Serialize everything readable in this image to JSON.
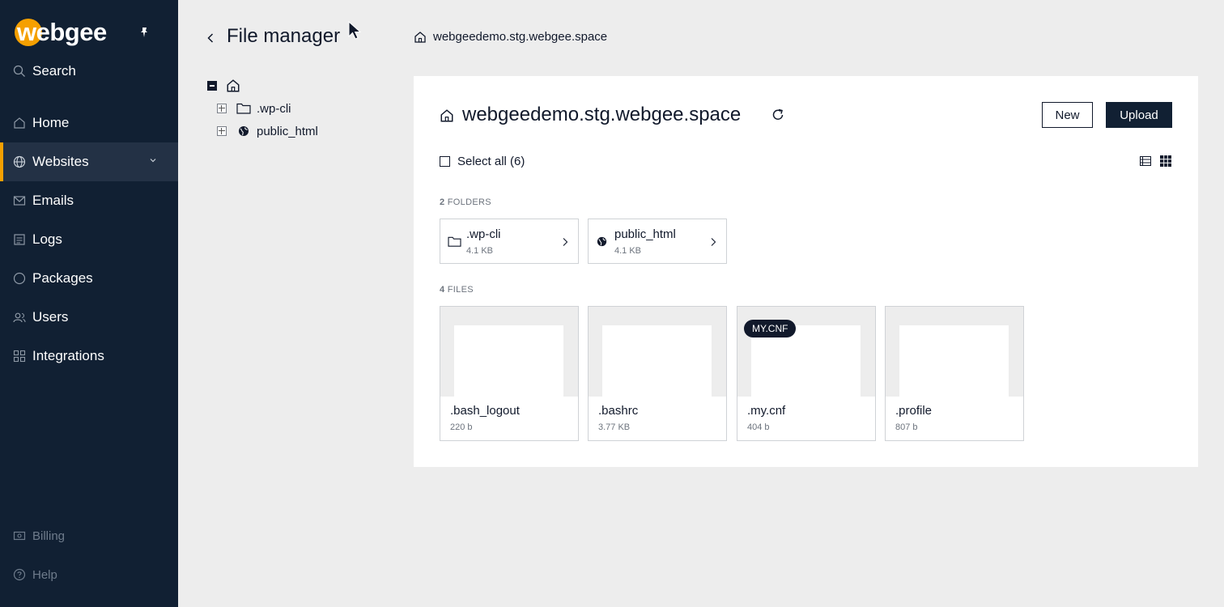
{
  "sidebar": {
    "logo": "webgee",
    "search_label": "Search",
    "items": [
      {
        "label": "Home",
        "icon": "home-icon"
      },
      {
        "label": "Websites",
        "icon": "globe-icon",
        "active": true
      },
      {
        "label": "Emails",
        "icon": "mail-icon"
      },
      {
        "label": "Logs",
        "icon": "logs-icon"
      },
      {
        "label": "Packages",
        "icon": "package-icon"
      },
      {
        "label": "Users",
        "icon": "users-icon"
      },
      {
        "label": "Integrations",
        "icon": "integrations-icon"
      }
    ],
    "bottom_items": [
      {
        "label": "Billing",
        "icon": "billing-icon"
      },
      {
        "label": "Help",
        "icon": "help-icon"
      }
    ]
  },
  "header": {
    "title": "File manager",
    "breadcrumb": "webgeedemo.stg.webgee.space"
  },
  "tree": {
    "items": [
      {
        "label": ".wp-cli",
        "icon": "folder-icon"
      },
      {
        "label": "public_html",
        "icon": "globe-icon"
      }
    ]
  },
  "panel": {
    "title": "webgeedemo.stg.webgee.space",
    "new_label": "New",
    "upload_label": "Upload",
    "select_all_label": "Select all (6)",
    "folders_count": "2",
    "folders_label": "FOLDERS",
    "files_count": "4",
    "files_label": "FILES",
    "folders": [
      {
        "name": ".wp-cli",
        "size": "4.1 KB",
        "icon": "folder-icon"
      },
      {
        "name": "public_html",
        "size": "4.1 KB",
        "icon": "globe-icon"
      }
    ],
    "files": [
      {
        "name": ".bash_logout",
        "size": "220 b",
        "badge": ""
      },
      {
        "name": ".bashrc",
        "size": "3.77 KB",
        "badge": ""
      },
      {
        "name": ".my.cnf",
        "size": "404 b",
        "badge": "MY.CNF"
      },
      {
        "name": ".profile",
        "size": "807 b",
        "badge": ""
      }
    ]
  },
  "colors": {
    "sidebar_bg": "#112033",
    "accent": "#f5a000",
    "page_bg": "#ededed"
  }
}
